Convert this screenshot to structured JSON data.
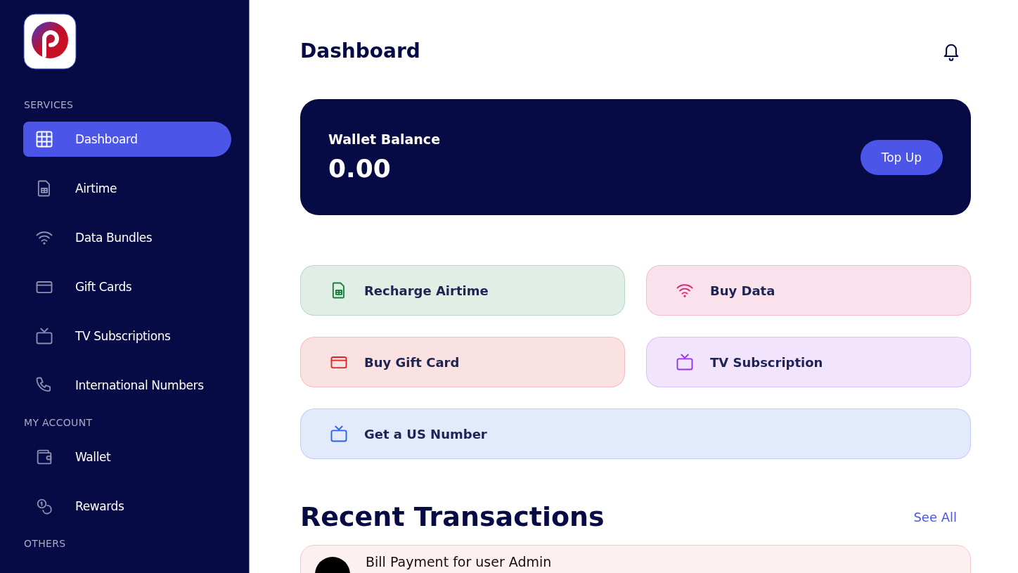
{
  "sidebar": {
    "sections": [
      {
        "title": "SERVICES",
        "items": [
          {
            "label": "Dashboard",
            "kind": "grid",
            "selected": true
          },
          {
            "label": "Airtime",
            "kind": "sim",
            "selected": false
          },
          {
            "label": "Data Bundles",
            "kind": "wifi",
            "selected": false
          },
          {
            "label": "Gift Cards",
            "kind": "card",
            "selected": false
          },
          {
            "label": "TV Subscriptions",
            "kind": "tv",
            "selected": false
          },
          {
            "label": "International Numbers",
            "kind": "phone",
            "selected": false
          }
        ]
      },
      {
        "title": "MY ACCOUNT",
        "items": [
          {
            "label": "Wallet",
            "kind": "wallet",
            "selected": false
          },
          {
            "label": "Rewards",
            "kind": "coins",
            "selected": false
          }
        ]
      },
      {
        "title": "OTHERS"
      }
    ]
  },
  "header": {
    "title": "Dashboard"
  },
  "wallet": {
    "label": "Wallet Balance",
    "amount": "0.00",
    "button": "Top Up"
  },
  "actions": [
    {
      "label": "Recharge Airtime",
      "kind": "sim",
      "color": "#15803d"
    },
    {
      "label": "Buy Data",
      "kind": "wifi",
      "color": "#db2777"
    },
    {
      "label": "Buy Gift Card",
      "kind": "card",
      "color": "#dc2626"
    },
    {
      "label": "TV Subscription",
      "kind": "tv",
      "color": "#9333ea"
    },
    {
      "label": "Get a US Number",
      "kind": "tv",
      "color": "#2563eb"
    }
  ],
  "transactions": {
    "title": "Recent Transactions",
    "link": "See All",
    "rows": [
      {
        "title": "Bill Payment for user Admin"
      }
    ]
  }
}
